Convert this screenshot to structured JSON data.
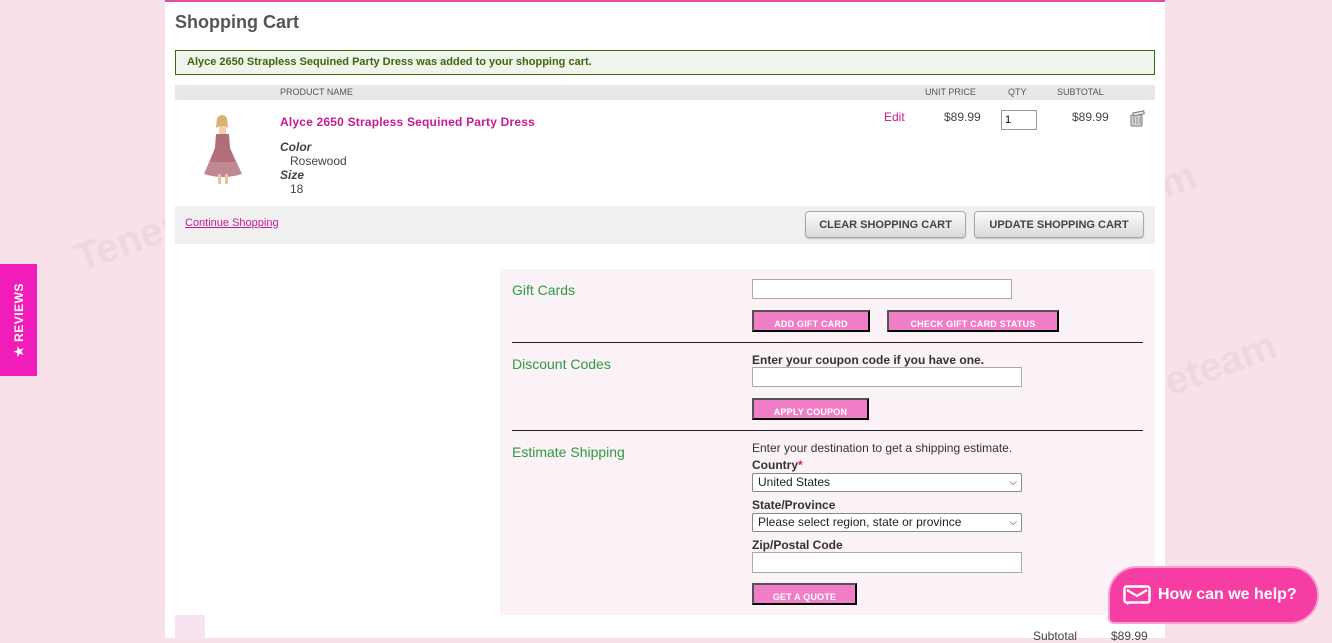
{
  "page": {
    "title": "Shopping Cart"
  },
  "success_message": "Alyce 2650 Strapless Sequined Party Dress was added to your shopping cart.",
  "table": {
    "headers": {
      "product_name": "PRODUCT NAME",
      "unit_price": "UNIT PRICE",
      "qty": "QTY",
      "subtotal": "SUBTOTAL"
    }
  },
  "item": {
    "name": "Alyce 2650 Strapless Sequined Party Dress",
    "options": [
      {
        "label": "Color",
        "value": "Rosewood"
      },
      {
        "label": "Size",
        "value": "18"
      }
    ],
    "edit_label": "Edit",
    "unit_price": "$89.99",
    "qty": "1",
    "subtotal": "$89.99"
  },
  "actions": {
    "continue_label": "Continue Shopping",
    "clear_label": "CLEAR SHOPPING CART",
    "update_label": "UPDATE SHOPPING CART"
  },
  "gift_cards": {
    "title": "Gift Cards",
    "add_label": "ADD GIFT CARD",
    "check_label": "CHECK GIFT CARD STATUS"
  },
  "discount": {
    "title": "Discount Codes",
    "prompt": "Enter your coupon code if you have one.",
    "apply_label": "APPLY COUPON"
  },
  "shipping": {
    "title": "Estimate Shipping",
    "prompt": "Enter your destination to get a shipping estimate.",
    "country_label": "Country",
    "required_mark": "*",
    "country_value": "United States",
    "state_label": "State/Province",
    "state_value": "Please select region, state or province",
    "zip_label": "Zip/Postal Code",
    "quote_label": "GET A QUOTE"
  },
  "totals": {
    "subtotal_label": "Subtotal",
    "subtotal_value": "$89.99"
  },
  "reviews_tab": {
    "label": "REVIEWS",
    "star": "★"
  },
  "chat": {
    "label": "How can we help?"
  },
  "watermark": {
    "text": "Tenereteam"
  },
  "colors": {
    "accent_pink": "#c71b92",
    "button_pink": "#f07ec6",
    "section_green": "#2e9b3e",
    "reviews_tab": "#f01dbb"
  }
}
